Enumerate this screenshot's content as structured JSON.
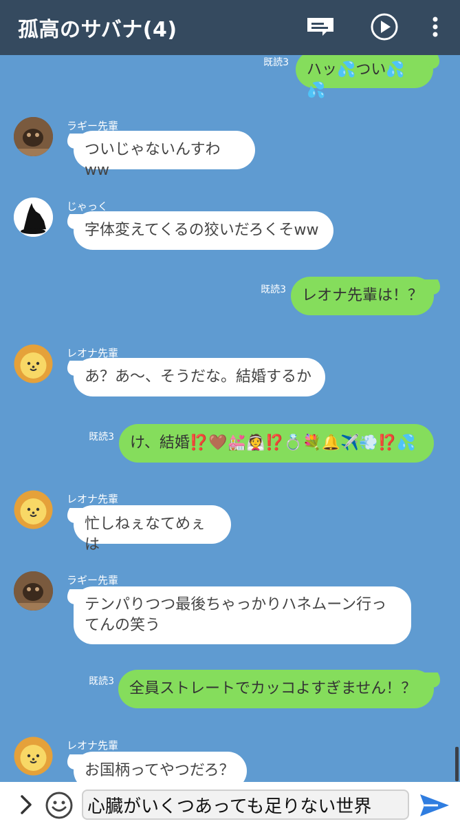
{
  "header": {
    "title": "孤高のサバナ(4)",
    "icons": [
      "note-icon",
      "play-icon",
      "more-vert-icon"
    ]
  },
  "messages": [
    {
      "type": "out",
      "read": "既読3",
      "text": "ハッ💦つい💦💦"
    },
    {
      "type": "in",
      "name": "ラギー先輩",
      "avatar": "hyena-avatar",
      "text": "ついじゃないんすわww"
    },
    {
      "type": "in",
      "name": "じゃっく",
      "avatar": "wolf-avatar",
      "text": "字体変えてくるの狡いだろくそww"
    },
    {
      "type": "out",
      "read": "既読3",
      "text": "レオナ先輩は！？"
    },
    {
      "type": "in",
      "name": "レオナ先輩",
      "avatar": "lion-avatar",
      "text": "あ？あ〜、そうだな。結婚するか"
    },
    {
      "type": "out",
      "read": "既読3",
      "text": "け、結婚⁉️🤎💒👰⁉️💍💐🔔✈️💨⁉️💦"
    },
    {
      "type": "in",
      "name": "レオナ先輩",
      "avatar": "lion-avatar",
      "text": "忙しねぇなてめぇは"
    },
    {
      "type": "in",
      "name": "ラギー先輩",
      "avatar": "hyena-avatar",
      "text": "テンパりつつ最後ちゃっかりハネムーン行ってんの笑う"
    },
    {
      "type": "out",
      "read": "既読3",
      "text": "全員ストレートでカッコよすぎません！？"
    },
    {
      "type": "in",
      "name": "レオナ先輩",
      "avatar": "lion-avatar",
      "text": "お国柄ってやつだろ？"
    }
  ],
  "input": {
    "value": "心臓がいくつあっても足りない世界",
    "icons": [
      "chevron-right-icon",
      "emoji-icon",
      "send-icon"
    ]
  },
  "colors": {
    "header_bg": "#354a5f",
    "chat_bg": "#5f9bd1",
    "outgoing_bubble": "#85dd5c",
    "incoming_bubble": "#ffffff",
    "send_accent": "#2f7de0"
  }
}
